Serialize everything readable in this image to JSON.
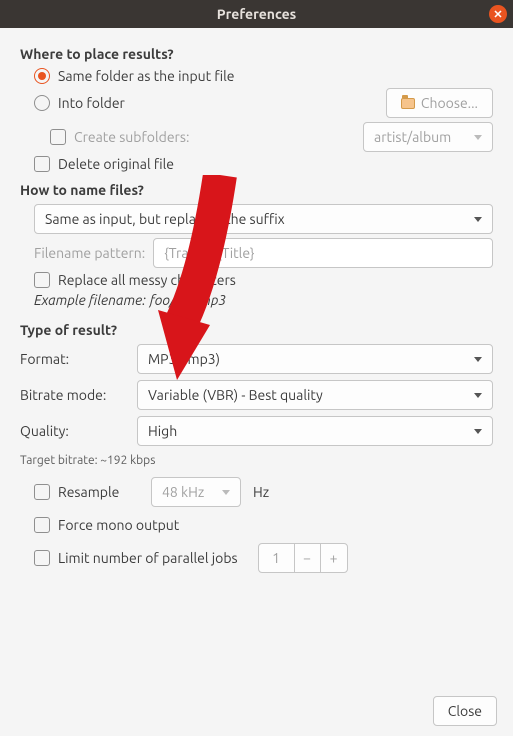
{
  "title": "Preferences",
  "sections": {
    "place": {
      "title": "Where to place results?",
      "same_folder": "Same folder as the input file",
      "into_folder": "Into folder",
      "choose": "Choose...",
      "create_sub": "Create subfolders:",
      "sub_pattern": "artist/album",
      "delete_orig": "Delete original file"
    },
    "name": {
      "title": "How to name files?",
      "mode": "Same as input, but replacing the suffix",
      "pattern_label": "Filename pattern:",
      "pattern_value": "{Track} - {Title}",
      "replace_messy": "Replace all messy characters",
      "example_label": "Example filename:",
      "example_value": "foo/bar.mp3"
    },
    "type": {
      "title": "Type of result?",
      "format_label": "Format:",
      "format_value": "MP3 (.mp3)",
      "bitrate_label": "Bitrate mode:",
      "bitrate_value": "Variable (VBR) - Best quality",
      "quality_label": "Quality:",
      "quality_value": "High",
      "target": "Target bitrate: ~192 kbps",
      "resample": "Resample",
      "resample_value": "48 kHz",
      "hz": "Hz",
      "force_mono": "Force mono output",
      "limit_jobs": "Limit number of parallel jobs",
      "jobs_value": "1"
    }
  },
  "footer": {
    "close": "Close"
  }
}
